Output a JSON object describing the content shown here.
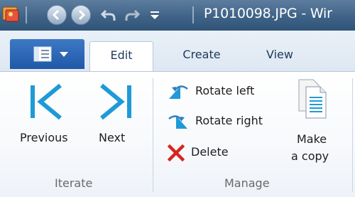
{
  "titlebar": {
    "title": "P1010098.JPG - Wir",
    "icons": [
      "photo-viewer-app-icon",
      "back-icon",
      "forward-icon",
      "undo-icon",
      "redo-icon",
      "customize-dropdown-icon"
    ]
  },
  "tabs": {
    "file_menu_icon": "document-menu-icon",
    "items": [
      {
        "label": "Edit"
      },
      {
        "label": "Create"
      },
      {
        "label": "View"
      }
    ]
  },
  "ribbon": {
    "iterate": {
      "group_label": "Iterate",
      "previous_label": "Previous",
      "next_label": "Next"
    },
    "manage": {
      "group_label": "Manage",
      "rotate_left_label": "Rotate left",
      "rotate_right_label": "Rotate right",
      "delete_label": "Delete",
      "make_copy_line1": "Make",
      "make_copy_line2": "a copy"
    }
  },
  "colors": {
    "titlebar": "#3f6387",
    "accent": "#1f9ad6",
    "delete_red": "#d8231f"
  }
}
